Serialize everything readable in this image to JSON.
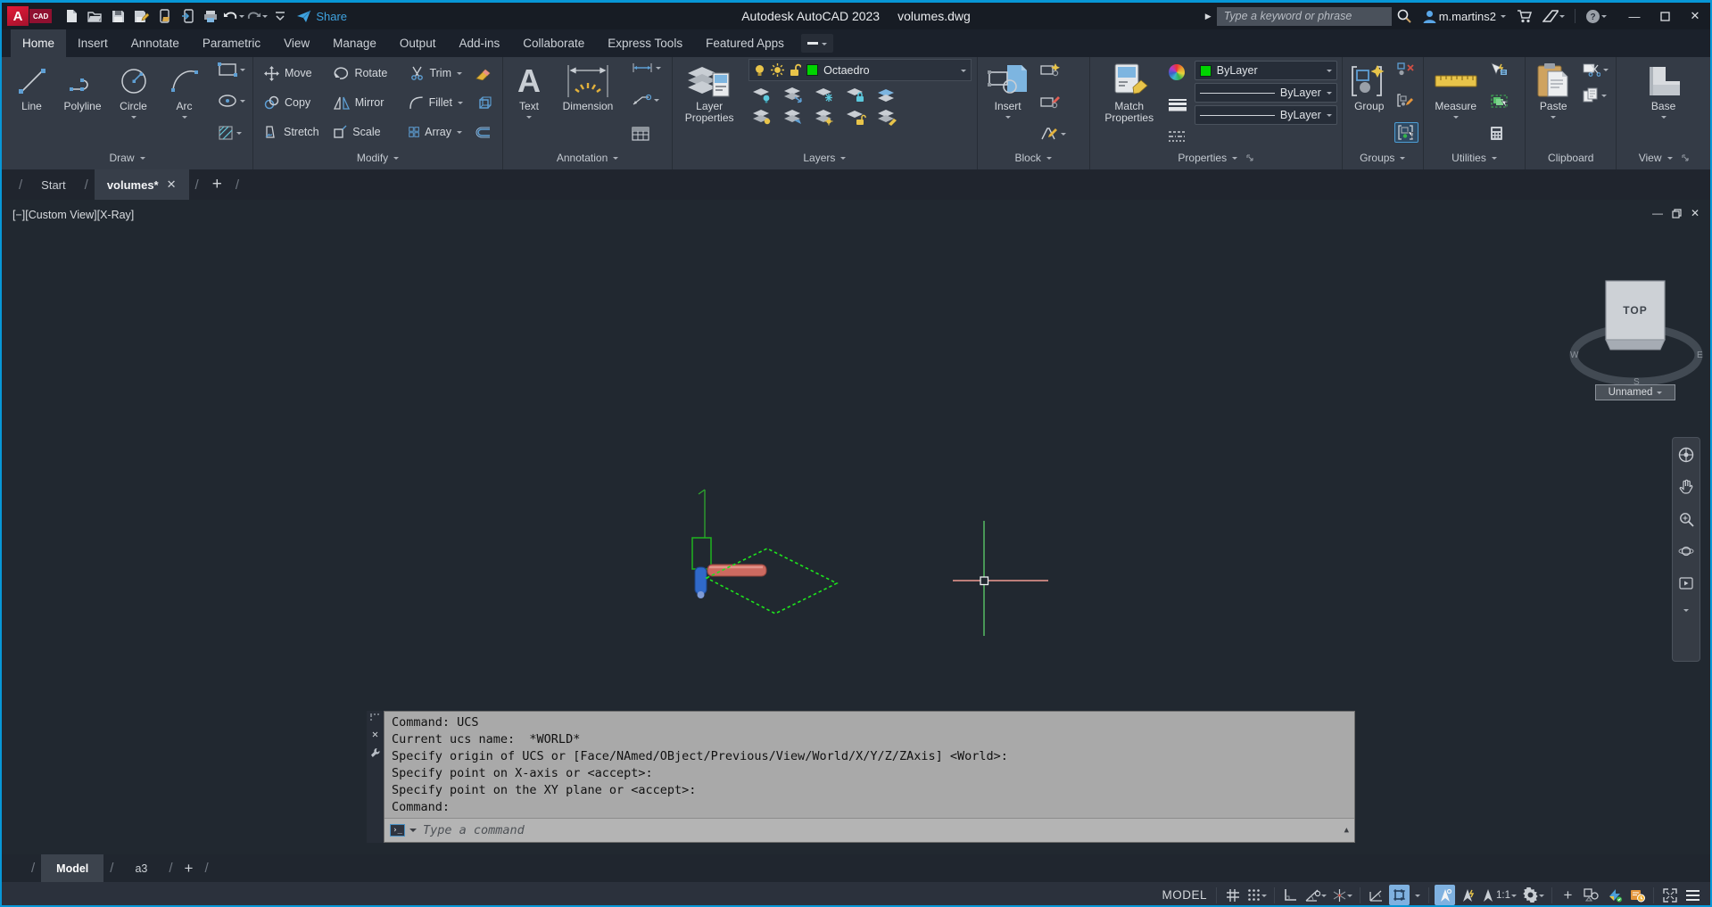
{
  "titlebar": {
    "logo_a": "A",
    "logo_cad": "CAD",
    "app_title": "Autodesk AutoCAD 2023",
    "doc_title": "volumes.dwg",
    "share_label": "Share",
    "search_placeholder": "Type a keyword or phrase",
    "username": "m.martins2"
  },
  "ribbon_tabs": [
    {
      "label": "Home"
    },
    {
      "label": "Insert"
    },
    {
      "label": "Annotate"
    },
    {
      "label": "Parametric"
    },
    {
      "label": "View"
    },
    {
      "label": "Manage"
    },
    {
      "label": "Output"
    },
    {
      "label": "Add-ins"
    },
    {
      "label": "Collaborate"
    },
    {
      "label": "Express Tools"
    },
    {
      "label": "Featured Apps"
    }
  ],
  "ribbon": {
    "draw": {
      "label": "Draw",
      "line": "Line",
      "polyline": "Polyline",
      "circle": "Circle",
      "arc": "Arc"
    },
    "modify": {
      "label": "Modify",
      "move": "Move",
      "rotate": "Rotate",
      "trim": "Trim",
      "copy": "Copy",
      "mirror": "Mirror",
      "fillet": "Fillet",
      "stretch": "Stretch",
      "scale": "Scale",
      "array": "Array"
    },
    "annotation": {
      "label": "Annotation",
      "text": "Text",
      "dimension": "Dimension"
    },
    "layers": {
      "label": "Layers",
      "layer_properties": "Layer Properties",
      "current_layer": "Octaedro"
    },
    "block": {
      "label": "Block",
      "insert": "Insert"
    },
    "properties": {
      "label": "Properties",
      "match_properties": "Match Properties",
      "object_color": "ByLayer",
      "lineweight": "ByLayer",
      "linetype": "ByLayer"
    },
    "groups": {
      "label": "Groups",
      "group": "Group"
    },
    "utilities": {
      "label": "Utilities",
      "measure": "Measure"
    },
    "clipboard": {
      "label": "Clipboard",
      "paste": "Paste"
    },
    "view": {
      "label": "View",
      "base": "Base"
    }
  },
  "file_tabs": {
    "start": "Start",
    "current": "volumes*"
  },
  "viewport": {
    "controls": "[−][Custom View][X-Ray]",
    "viewcube_face": "TOP",
    "view_name": "Unnamed",
    "compass_w": "W",
    "compass_s": "S",
    "compass_e": "E"
  },
  "command_window": {
    "lines": [
      "Command: UCS",
      "Current ucs name:  *WORLD*",
      "Specify origin of UCS or [Face/NAmed/OBject/Previous/View/World/X/Y/Z/ZAxis] <World>:",
      "Specify point on X-axis or <accept>:",
      "Specify point on the XY plane or <accept>:",
      "Command:"
    ],
    "placeholder": "Type a command"
  },
  "layout_tabs": {
    "model": "Model",
    "a3": "a3"
  },
  "status_bar": {
    "space_label": "MODEL",
    "annotation_scale": "1:1"
  }
}
